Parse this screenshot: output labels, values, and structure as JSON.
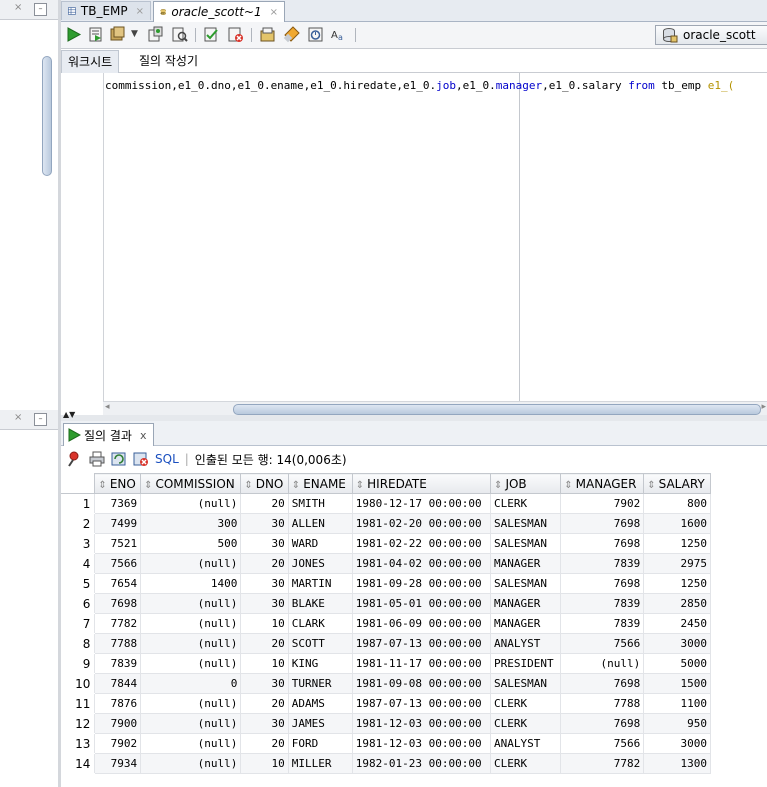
{
  "tabs": [
    {
      "label": "TB_EMP",
      "close": "×"
    },
    {
      "label": "oracle_scott~1",
      "close": "×"
    }
  ],
  "toolbar": {
    "icons": [
      "run-statement-icon",
      "run-script-icon",
      "commit-icon",
      "dropdown-arrow-icon",
      "rollback-icon",
      "explain-plan-icon",
      "autotrace-icon",
      "sql-tuning-icon",
      "clear-icon",
      "sql-history-icon",
      "format-icon",
      "find-icon",
      "case-icon"
    ],
    "connection": "oracle_scott"
  },
  "subtabs": [
    "워크시트",
    "질의 작성기"
  ],
  "editor": {
    "code_parts": [
      {
        "t": "commission,e1_0.dno,e1_0.ename,e1_0.hiredate,e1_0.",
        "c": "plain"
      },
      {
        "t": "job",
        "c": "kw"
      },
      {
        "t": ",e1_0.",
        "c": "plain"
      },
      {
        "t": "manager",
        "c": "kw"
      },
      {
        "t": ",e1_0.salary ",
        "c": "plain"
      },
      {
        "t": "from",
        "c": "kw"
      },
      {
        "t": " tb_emp ",
        "c": "plain"
      },
      {
        "t": "e1_(",
        "c": "fn"
      }
    ]
  },
  "results": {
    "tab_label": "질의 결과",
    "tab_close": "x",
    "sql_label": "SQL",
    "status": "인출된 모든 행: 14(0,006초)",
    "columns": [
      "ENO",
      "COMMISSION",
      "DNO",
      "ENAME",
      "HIREDATE",
      "JOB",
      "MANAGER",
      "SALARY"
    ],
    "rows": [
      [
        "1",
        "7369",
        "(null)",
        "20",
        "SMITH",
        "1980-12-17 00:00:00",
        "CLERK",
        "7902",
        "800"
      ],
      [
        "2",
        "7499",
        "300",
        "30",
        "ALLEN",
        "1981-02-20 00:00:00",
        "SALESMAN",
        "7698",
        "1600"
      ],
      [
        "3",
        "7521",
        "500",
        "30",
        "WARD",
        "1981-02-22 00:00:00",
        "SALESMAN",
        "7698",
        "1250"
      ],
      [
        "4",
        "7566",
        "(null)",
        "20",
        "JONES",
        "1981-04-02 00:00:00",
        "MANAGER",
        "7839",
        "2975"
      ],
      [
        "5",
        "7654",
        "1400",
        "30",
        "MARTIN",
        "1981-09-28 00:00:00",
        "SALESMAN",
        "7698",
        "1250"
      ],
      [
        "6",
        "7698",
        "(null)",
        "30",
        "BLAKE",
        "1981-05-01 00:00:00",
        "MANAGER",
        "7839",
        "2850"
      ],
      [
        "7",
        "7782",
        "(null)",
        "10",
        "CLARK",
        "1981-06-09 00:00:00",
        "MANAGER",
        "7839",
        "2450"
      ],
      [
        "8",
        "7788",
        "(null)",
        "20",
        "SCOTT",
        "1987-07-13 00:00:00",
        "ANALYST",
        "7566",
        "3000"
      ],
      [
        "9",
        "7839",
        "(null)",
        "10",
        "KING",
        "1981-11-17 00:00:00",
        "PRESIDENT",
        "(null)",
        "5000"
      ],
      [
        "10",
        "7844",
        "0",
        "30",
        "TURNER",
        "1981-09-08 00:00:00",
        "SALESMAN",
        "7698",
        "1500"
      ],
      [
        "11",
        "7876",
        "(null)",
        "20",
        "ADAMS",
        "1987-07-13 00:00:00",
        "CLERK",
        "7788",
        "1100"
      ],
      [
        "12",
        "7900",
        "(null)",
        "30",
        "JAMES",
        "1981-12-03 00:00:00",
        "CLERK",
        "7698",
        "950"
      ],
      [
        "13",
        "7902",
        "(null)",
        "20",
        "FORD",
        "1981-12-03 00:00:00",
        "ANALYST",
        "7566",
        "3000"
      ],
      [
        "14",
        "7934",
        "(null)",
        "10",
        "MILLER",
        "1982-01-23 00:00:00",
        "CLERK",
        "7782",
        "1300"
      ]
    ]
  },
  "colors": {
    "accent": "#0000cc",
    "function": "#b49200",
    "run": "#2e9c2e"
  }
}
